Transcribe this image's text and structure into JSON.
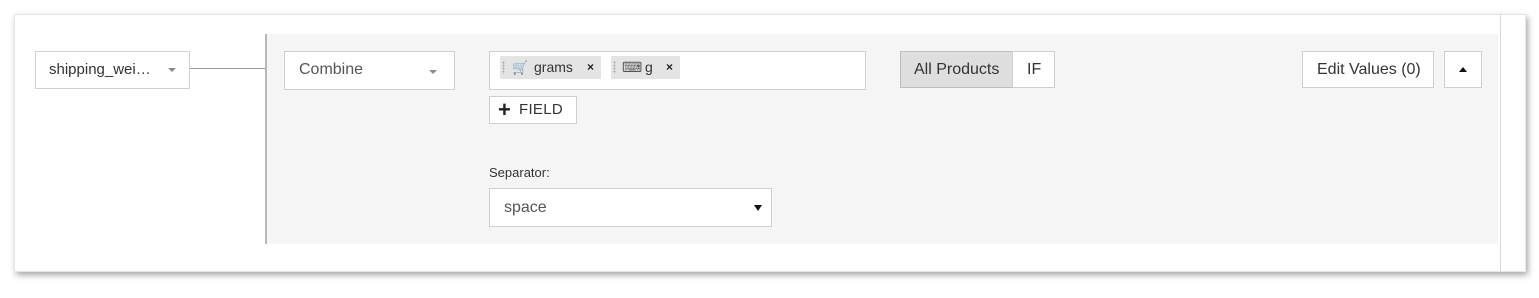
{
  "source_field": {
    "value": "shipping_wei…",
    "icon": "caret-down-icon"
  },
  "operation": {
    "value": "Combine",
    "icon": "caret-down-icon"
  },
  "fields": [
    {
      "icon": "shopping-cart-icon",
      "icon_glyph": "🛒",
      "label": "grams",
      "remove": "×"
    },
    {
      "icon": "keyboard-icon",
      "icon_glyph": "⌨",
      "label": "g",
      "remove": "×"
    }
  ],
  "add_field": {
    "icon": "plus-icon",
    "icon_glyph": "+",
    "label": "FIELD"
  },
  "separator": {
    "label": "Separator:",
    "value": "space",
    "icon": "caret-down-icon"
  },
  "scope_toggle": {
    "all_products": "All Products",
    "if": "IF",
    "selected": "All Products"
  },
  "edit_values": {
    "label": "Edit Values (0)"
  },
  "collapse": {
    "icon": "caret-up-icon"
  }
}
